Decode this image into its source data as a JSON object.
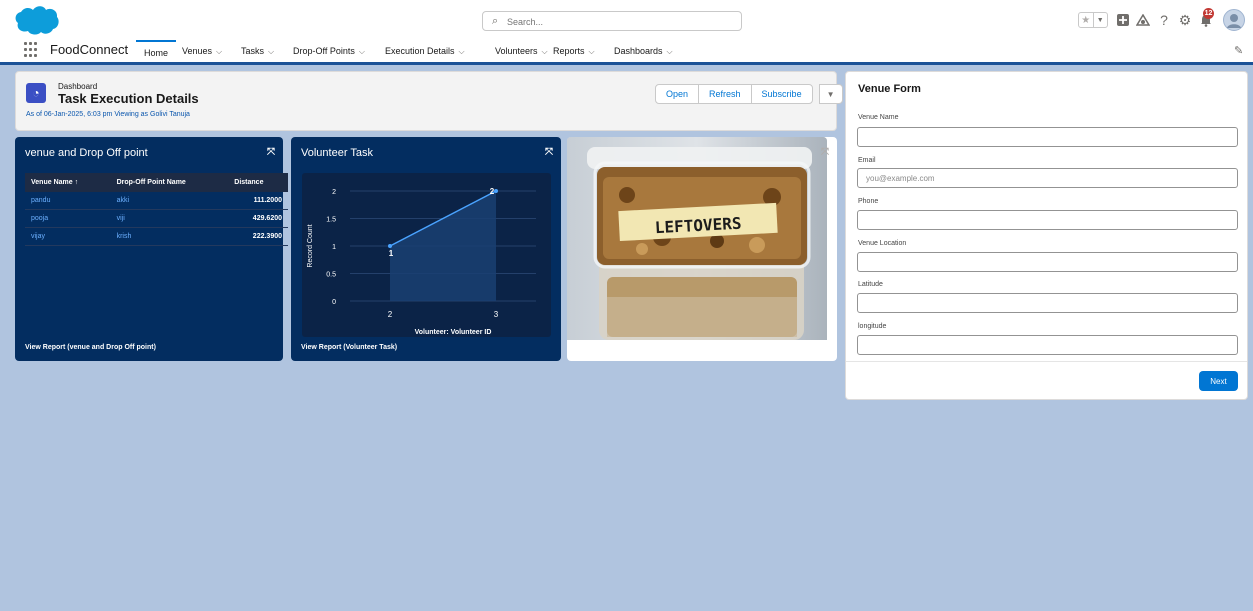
{
  "header": {
    "search_placeholder": "Search...",
    "notification_count": "12",
    "icons": [
      "favorite-star-icon",
      "global-add-icon",
      "trailhead-icon",
      "help-icon",
      "setup-gear-icon",
      "notification-bell-icon"
    ]
  },
  "nav": {
    "app_name": "FoodConnect",
    "items": [
      {
        "label": "Home"
      },
      {
        "label": "Venues"
      },
      {
        "label": "Tasks"
      },
      {
        "label": "Drop-Off Points"
      },
      {
        "label": "Execution Details"
      },
      {
        "label": "Volunteers"
      },
      {
        "label": "Reports"
      },
      {
        "label": "Dashboards"
      }
    ]
  },
  "dashboard": {
    "type_label": "Dashboard",
    "title": "Task Execution Details",
    "as_of": "As of 06-Jan-2025, 6:03 pm Viewing as Golivi Tanuja",
    "actions": {
      "open": "Open",
      "refresh": "Refresh",
      "subscribe": "Subscribe"
    }
  },
  "venue_widget": {
    "title": "venue and Drop Off point",
    "columns": [
      "Venue Name ↑",
      "Drop-Off Point Name",
      "Distance"
    ],
    "rows": [
      [
        "pandu",
        "akki",
        "111.2000"
      ],
      [
        "pooja",
        "viji",
        "429.6200"
      ],
      [
        "vijay",
        "krish",
        "222.3900"
      ]
    ],
    "footer": "View Report (venue and Drop Off point)"
  },
  "volunteer_widget": {
    "title": "Volunteer Task",
    "footer": "View Report (Volunteer Task)"
  },
  "chart_data": {
    "type": "area",
    "title": "Volunteer Task",
    "xlabel": "Volunteer: Volunteer ID",
    "ylabel": "Record Count",
    "categories": [
      "2",
      "3"
    ],
    "values": [
      1,
      2
    ],
    "data_labels": [
      "1",
      "2"
    ],
    "yticks": [
      "0",
      "0.5",
      "1",
      "1.5",
      "2"
    ],
    "ylim": [
      0,
      2
    ],
    "grid": true,
    "colors": {
      "line": "#4aa3ff",
      "fill": "#1a3f72"
    }
  },
  "image_widget": {
    "label_text": "LEFTOVERS"
  },
  "venue_form": {
    "title": "Venue Form",
    "fields": [
      {
        "label": "Venue Name",
        "placeholder": ""
      },
      {
        "label": "Email",
        "placeholder": "you@example.com"
      },
      {
        "label": "Phone",
        "placeholder": ""
      },
      {
        "label": "Venue Location",
        "placeholder": ""
      },
      {
        "label": "Latitude",
        "placeholder": ""
      },
      {
        "label": "longitude",
        "placeholder": ""
      }
    ],
    "next_label": "Next"
  },
  "colors": {
    "brand": "#0176d3",
    "nav_accent": "#1b5297",
    "widget_bg": "#032d60",
    "page_bg": "#b0c4df"
  }
}
